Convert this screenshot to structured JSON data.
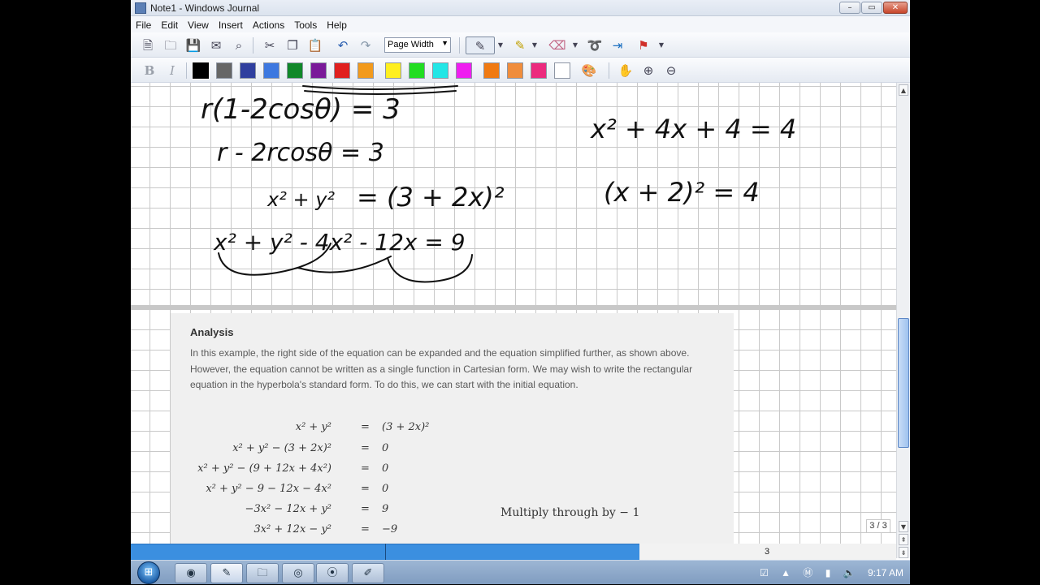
{
  "window": {
    "title": "Note1 - Windows Journal",
    "minimize": "–",
    "maximize": "▭",
    "close": "✕"
  },
  "menu": [
    "File",
    "Edit",
    "View",
    "Insert",
    "Actions",
    "Tools",
    "Help"
  ],
  "toolbar": {
    "zoom_value": "Page Width",
    "bold_label": "B",
    "italic_label": "I"
  },
  "palette": {
    "colors": [
      "#000000",
      "#666666",
      "#2f3f9f",
      "#3d78e0",
      "#11882a",
      "#7a1a99",
      "#e0201f",
      "#f29a1c",
      "#ffef1f",
      "#22dd22",
      "#22e6e6",
      "#ef1ef0",
      "#f07a12",
      "#f08d3c",
      "#ec2b7e",
      "#ffffff"
    ],
    "selected": "#000000"
  },
  "ink": {
    "line1": "r(1-2cosθ) = 3",
    "line2": "r - 2rcosθ = 3",
    "line3_lhs": "x² + y²",
    "line3_rhs": "= (3 + 2x)²",
    "line4": "x² + y² - 4x² - 12x = 9",
    "right1": "x² + 4x + 4 = 4",
    "right2": "(x + 2)² = 4"
  },
  "textbook": {
    "heading": "Analysis",
    "paragraph": "In this example, the right side of the equation can be expanded and the equation simplified further, as shown above. However, the equation cannot be written as a single function in Cartesian form. We may wish to write the rectangular equation in the hyperbola's standard form. To do this, we can start with the initial equation.",
    "equations": [
      {
        "lhs": "x² + y²",
        "rhs": "(3 + 2x)²"
      },
      {
        "lhs": "x² + y² − (3 + 2x)²",
        "rhs": "0"
      },
      {
        "lhs": "x² + y² − (9 + 12x + 4x²)",
        "rhs": "0"
      },
      {
        "lhs": "x² + y² − 9 − 12x − 4x²",
        "rhs": "0"
      },
      {
        "lhs": "−3x² − 12x + y²",
        "rhs": "9"
      },
      {
        "lhs": "3x² + 12x − y²",
        "rhs": "−9"
      }
    ],
    "equals_sign": "=",
    "note": "Multiply through by  − 1"
  },
  "pager": "3 / 3",
  "page_number": "3",
  "taskbar": {
    "start": "⊞",
    "clock": "9:17 AM"
  }
}
